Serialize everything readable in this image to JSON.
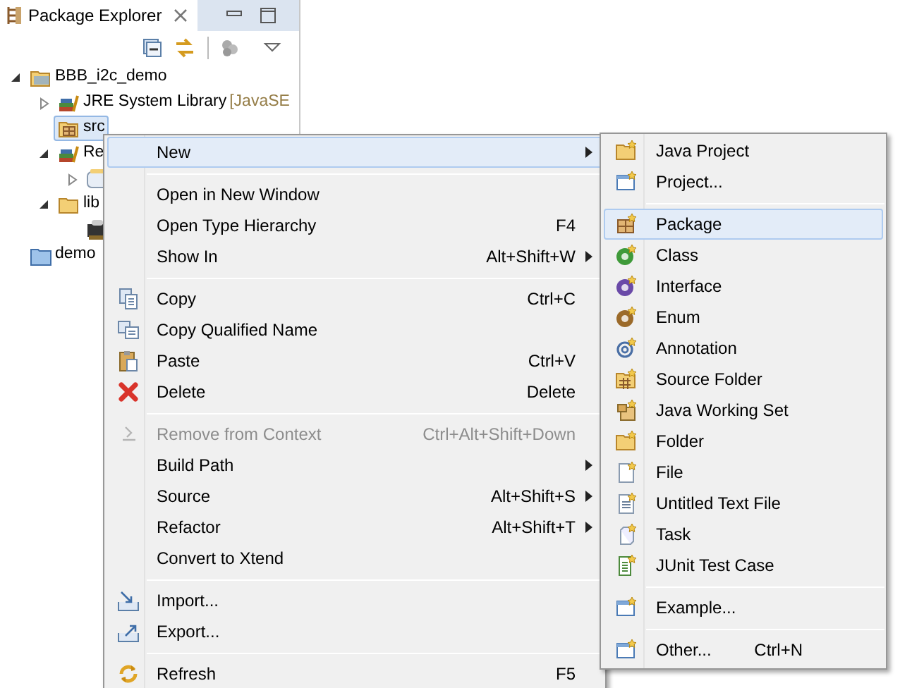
{
  "panel": {
    "title": "Package Explorer"
  },
  "tree": [
    {
      "kind": "project",
      "label": "BBB_i2c_demo",
      "expanded": true,
      "selected": false,
      "children": [
        {
          "kind": "library",
          "label": "JRE System Library",
          "suffix": "[JavaSE",
          "expanded": false,
          "selected": false
        },
        {
          "kind": "source",
          "label": "src",
          "selected": true
        },
        {
          "kind": "library",
          "label": "Re",
          "expanded": true,
          "selected": false,
          "children": [
            {
              "kind": "binary",
              "expanded": false,
              "selected": false
            }
          ]
        },
        {
          "kind": "folder",
          "label": "lib",
          "expanded": true,
          "selected": false,
          "children": [
            {
              "kind": "jar",
              "selected": false
            }
          ]
        }
      ]
    },
    {
      "kind": "closed-project",
      "label": "demo",
      "selected": false
    }
  ],
  "context_menu": [
    {
      "kind": "item",
      "label": "New",
      "submenu": true,
      "selected": true,
      "disabled": false
    },
    {
      "kind": "separator"
    },
    {
      "kind": "item",
      "label": "Open in New Window",
      "selected": false,
      "disabled": false
    },
    {
      "kind": "item",
      "label": "Open Type Hierarchy",
      "shortcut": "F4",
      "selected": false,
      "disabled": false
    },
    {
      "kind": "item",
      "label": "Show In",
      "shortcut": "Alt+Shift+W",
      "submenu": true,
      "selected": false,
      "disabled": false
    },
    {
      "kind": "separator"
    },
    {
      "kind": "item",
      "label": "Copy",
      "shortcut": "Ctrl+C",
      "selected": false,
      "disabled": false
    },
    {
      "kind": "item",
      "label": "Copy Qualified Name",
      "selected": false,
      "disabled": false
    },
    {
      "kind": "item",
      "label": "Paste",
      "shortcut": "Ctrl+V",
      "selected": false,
      "disabled": false
    },
    {
      "kind": "item",
      "label": "Delete",
      "shortcut": "Delete",
      "selected": false,
      "disabled": false
    },
    {
      "kind": "separator"
    },
    {
      "kind": "item",
      "label": "Remove from Context",
      "shortcut": "Ctrl+Alt+Shift+Down",
      "selected": false,
      "disabled": true
    },
    {
      "kind": "item",
      "label": "Build Path",
      "submenu": true,
      "selected": false,
      "disabled": false
    },
    {
      "kind": "item",
      "label": "Source",
      "shortcut": "Alt+Shift+S",
      "submenu": true,
      "selected": false,
      "disabled": false
    },
    {
      "kind": "item",
      "label": "Refactor",
      "shortcut": "Alt+Shift+T",
      "submenu": true,
      "selected": false,
      "disabled": false
    },
    {
      "kind": "item",
      "label": "Convert to Xtend",
      "selected": false,
      "disabled": false
    },
    {
      "kind": "separator"
    },
    {
      "kind": "item",
      "label": "Import...",
      "selected": false,
      "disabled": false
    },
    {
      "kind": "item",
      "label": "Export...",
      "selected": false,
      "disabled": false
    },
    {
      "kind": "separator"
    },
    {
      "kind": "item",
      "label": "Refresh",
      "shortcut": "F5",
      "selected": false,
      "disabled": false
    }
  ],
  "new_submenu": [
    {
      "kind": "item",
      "label": "Java Project",
      "selected": false
    },
    {
      "kind": "item",
      "label": "Project...",
      "selected": false
    },
    {
      "kind": "separator"
    },
    {
      "kind": "item",
      "label": "Package",
      "selected": true
    },
    {
      "kind": "item",
      "label": "Class",
      "selected": false
    },
    {
      "kind": "item",
      "label": "Interface",
      "selected": false
    },
    {
      "kind": "item",
      "label": "Enum",
      "selected": false
    },
    {
      "kind": "item",
      "label": "Annotation",
      "selected": false
    },
    {
      "kind": "item",
      "label": "Source Folder",
      "selected": false
    },
    {
      "kind": "item",
      "label": "Java Working Set",
      "selected": false
    },
    {
      "kind": "item",
      "label": "Folder",
      "selected": false
    },
    {
      "kind": "item",
      "label": "File",
      "selected": false
    },
    {
      "kind": "item",
      "label": "Untitled Text File",
      "selected": false
    },
    {
      "kind": "item",
      "label": "Task",
      "selected": false
    },
    {
      "kind": "item",
      "label": "JUnit Test Case",
      "selected": false
    },
    {
      "kind": "separator"
    },
    {
      "kind": "item",
      "label": "Example...",
      "selected": false
    },
    {
      "kind": "separator"
    },
    {
      "kind": "item",
      "label": "Other...",
      "shortcut": "Ctrl+N",
      "selected": false
    }
  ]
}
